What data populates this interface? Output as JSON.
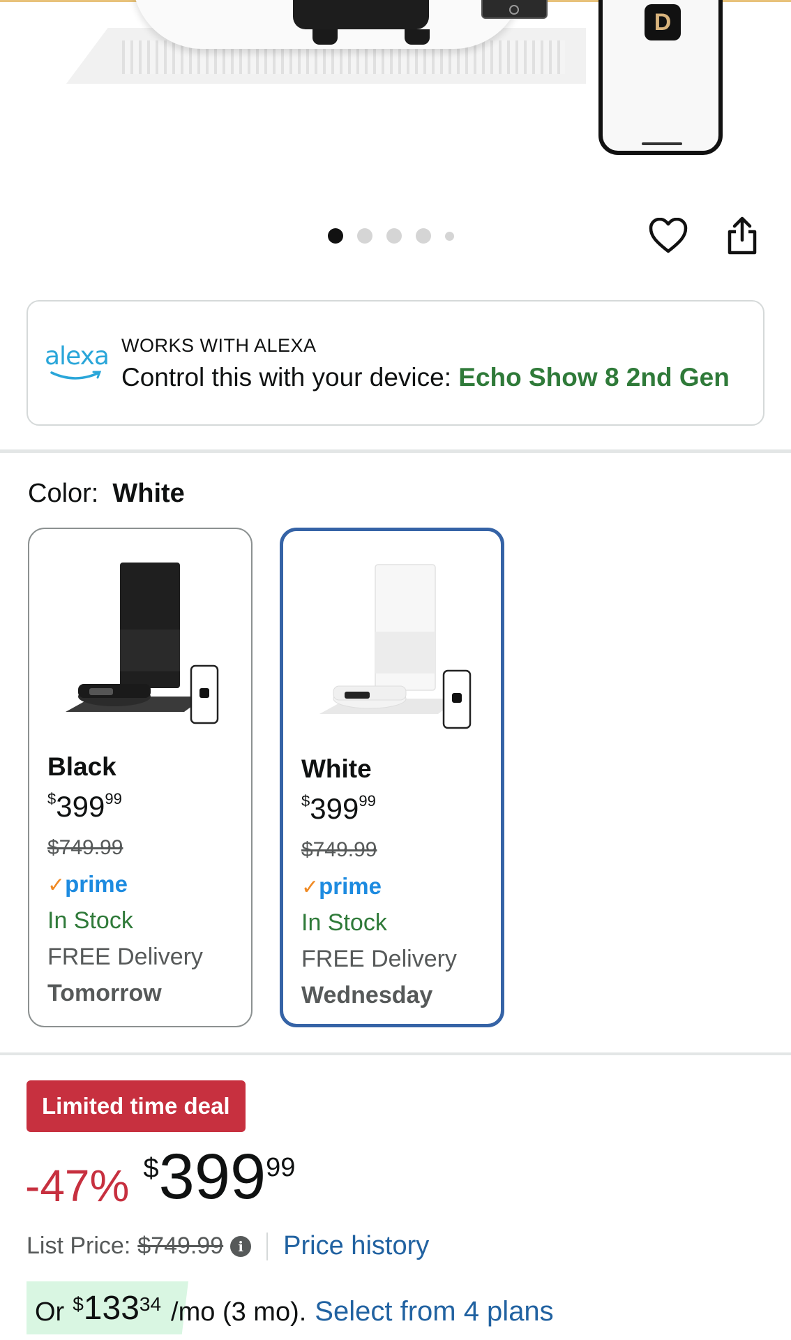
{
  "gallery": {
    "brand_logo": "D",
    "dot_count": 5,
    "active_index": 0,
    "icons": {
      "favorite": "heart-icon",
      "share": "share-icon"
    }
  },
  "alexa": {
    "logo_text": "alexa",
    "kicker": "WORKS WITH ALEXA",
    "line_prefix": "Control this with your device: ",
    "device": "Echo Show 8 2nd Gen"
  },
  "color": {
    "label": "Color:",
    "selected": "White",
    "options": [
      {
        "name": "Black",
        "price_symbol": "$",
        "price_whole": "399",
        "price_fraction": "99",
        "list_price": "$749.99",
        "prime": "prime",
        "stock": "In Stock",
        "delivery": "FREE Delivery",
        "day": "Tomorrow",
        "phone_logo": "D"
      },
      {
        "name": "White",
        "price_symbol": "$",
        "price_whole": "399",
        "price_fraction": "99",
        "list_price": "$749.99",
        "prime": "prime",
        "stock": "In Stock",
        "delivery": "FREE Delivery",
        "day": "Wednesday",
        "phone_logo": "D"
      }
    ]
  },
  "deal": {
    "badge": "Limited time deal",
    "discount": "-47%",
    "price_symbol": "$",
    "price_whole": "399",
    "price_fraction": "99",
    "list_label": "List Price:",
    "list_price": "$749.99",
    "info_icon": "i",
    "price_history": "Price history"
  },
  "plan": {
    "prefix": "Or",
    "symbol": "$",
    "whole": "133",
    "fraction": "34",
    "suffix": "/mo (3 mo).",
    "link": "Select from 4 plans"
  },
  "colors": {
    "deal_red": "#c7303f",
    "link_blue": "#2162a1",
    "stock_green": "#2f7a39",
    "selected_border": "#3563a6",
    "prime_blue": "#1d8be0"
  }
}
